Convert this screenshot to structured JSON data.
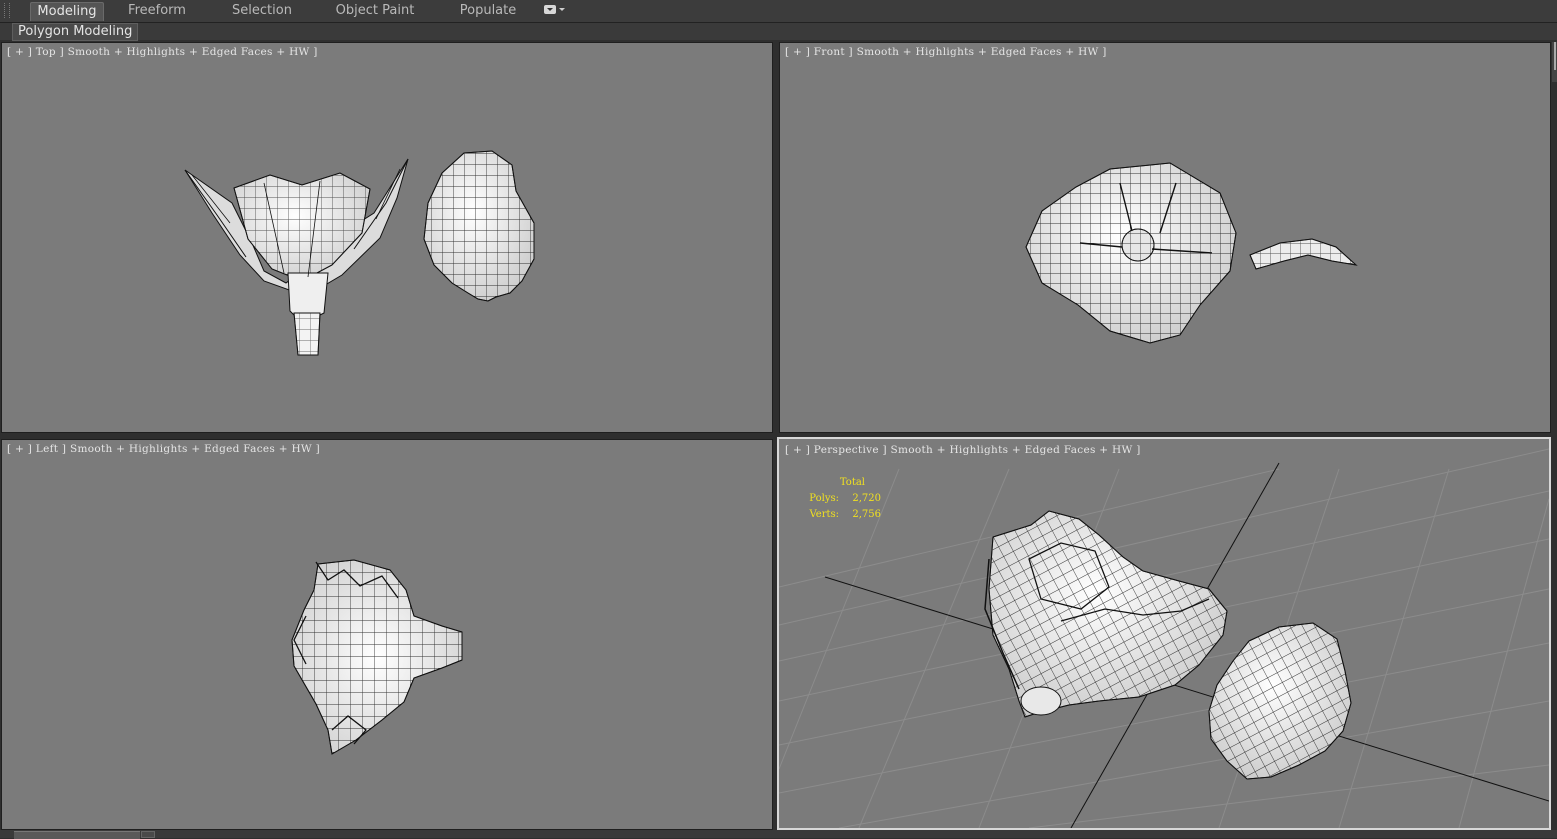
{
  "ribbon": {
    "tabs": [
      {
        "label": "Modeling",
        "active": true
      },
      {
        "label": "Freeform",
        "active": false
      },
      {
        "label": "Selection",
        "active": false
      },
      {
        "label": "Object Paint",
        "active": false
      },
      {
        "label": "Populate",
        "active": false
      }
    ],
    "menu_icon": "dropdown-menu-icon",
    "sub_panel": "Polygon Modeling"
  },
  "viewports": {
    "top": {
      "label": "[ + ] Top ] Smooth + Highlights + Edged Faces + HW ]"
    },
    "front": {
      "label": "[ + ] Front ] Smooth + Highlights + Edged Faces + HW ]"
    },
    "left": {
      "label": "[ + ] Left ] Smooth + Highlights + Edged Faces + HW ]"
    },
    "perspective": {
      "label": "[ + ] Perspective ] Smooth + Highlights + Edged Faces + HW ]",
      "stats": {
        "total_label": "Total",
        "polys_label": "Polys:",
        "polys_value": "2,720",
        "verts_label": "Verts:",
        "verts_value": "2,756"
      }
    }
  },
  "colors": {
    "viewport_bg": "#7b7b7b",
    "active_viewport_border": "#d7d7d7",
    "stats_text": "#f0e020",
    "mesh_fill": "#f2f2f2",
    "wire": "#111111"
  }
}
